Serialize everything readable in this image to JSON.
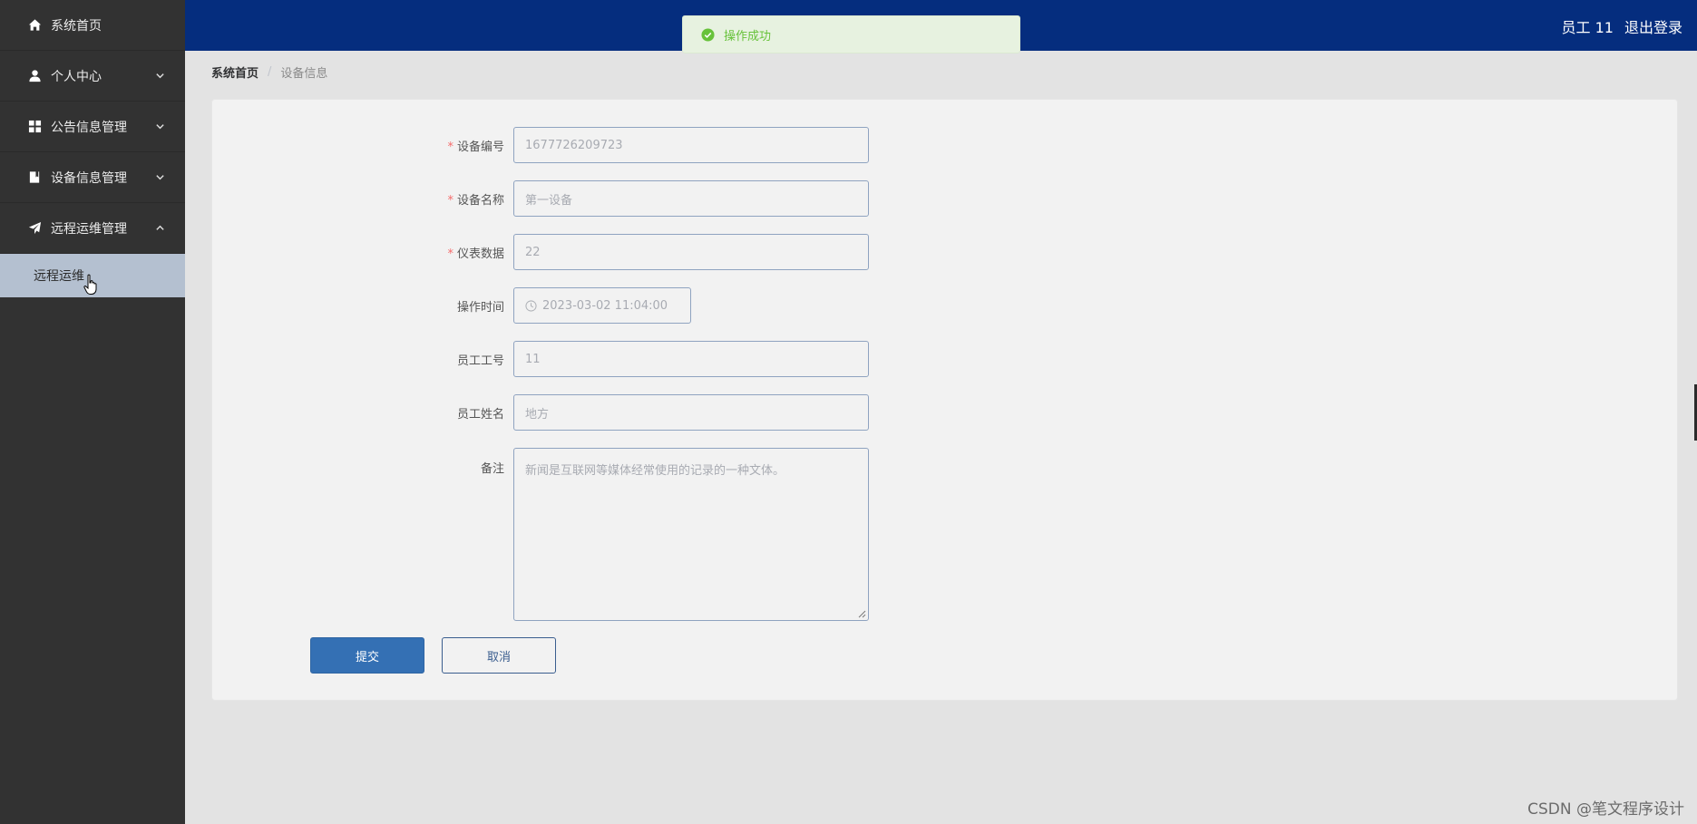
{
  "sidebar": {
    "items": [
      {
        "label": "系统首页",
        "icon": "home-icon"
      },
      {
        "label": "个人中心",
        "icon": "user-icon",
        "chevron": "down"
      },
      {
        "label": "公告信息管理",
        "icon": "grid-icon",
        "chevron": "down"
      },
      {
        "label": "设备信息管理",
        "icon": "book-icon",
        "chevron": "down"
      },
      {
        "label": "远程运维管理",
        "icon": "send-icon",
        "chevron": "up"
      }
    ],
    "submenu": [
      {
        "label": "远程运维"
      }
    ]
  },
  "header": {
    "user": "员工 11",
    "logout": "退出登录"
  },
  "toast": {
    "message": "操作成功",
    "color": "#67c23a"
  },
  "breadcrumb": {
    "home": "系统首页",
    "separator": "/",
    "current": "设备信息"
  },
  "form": {
    "fields": [
      {
        "label": "设备编号",
        "required": true,
        "value": "1677726209723"
      },
      {
        "label": "设备名称",
        "required": true,
        "value": "第一设备"
      },
      {
        "label": "仪表数据",
        "required": true,
        "value": "22"
      },
      {
        "label": "操作时间",
        "required": false,
        "value": "2023-03-02 11:04:00"
      },
      {
        "label": "员工工号",
        "required": false,
        "value": "11"
      },
      {
        "label": "员工姓名",
        "required": false,
        "value": "地方"
      },
      {
        "label": "备注",
        "required": false,
        "value": "新闻是互联网等媒体经常使用的记录的一种文体。"
      }
    ],
    "submit_label": "提交",
    "cancel_label": "取消"
  },
  "watermark": "CSDN @笔文程序设计",
  "colors": {
    "topbar": "#052d7e",
    "sidebar": "#323232",
    "submenu_active": "#b4c0d0",
    "primary": "#3470b4"
  }
}
